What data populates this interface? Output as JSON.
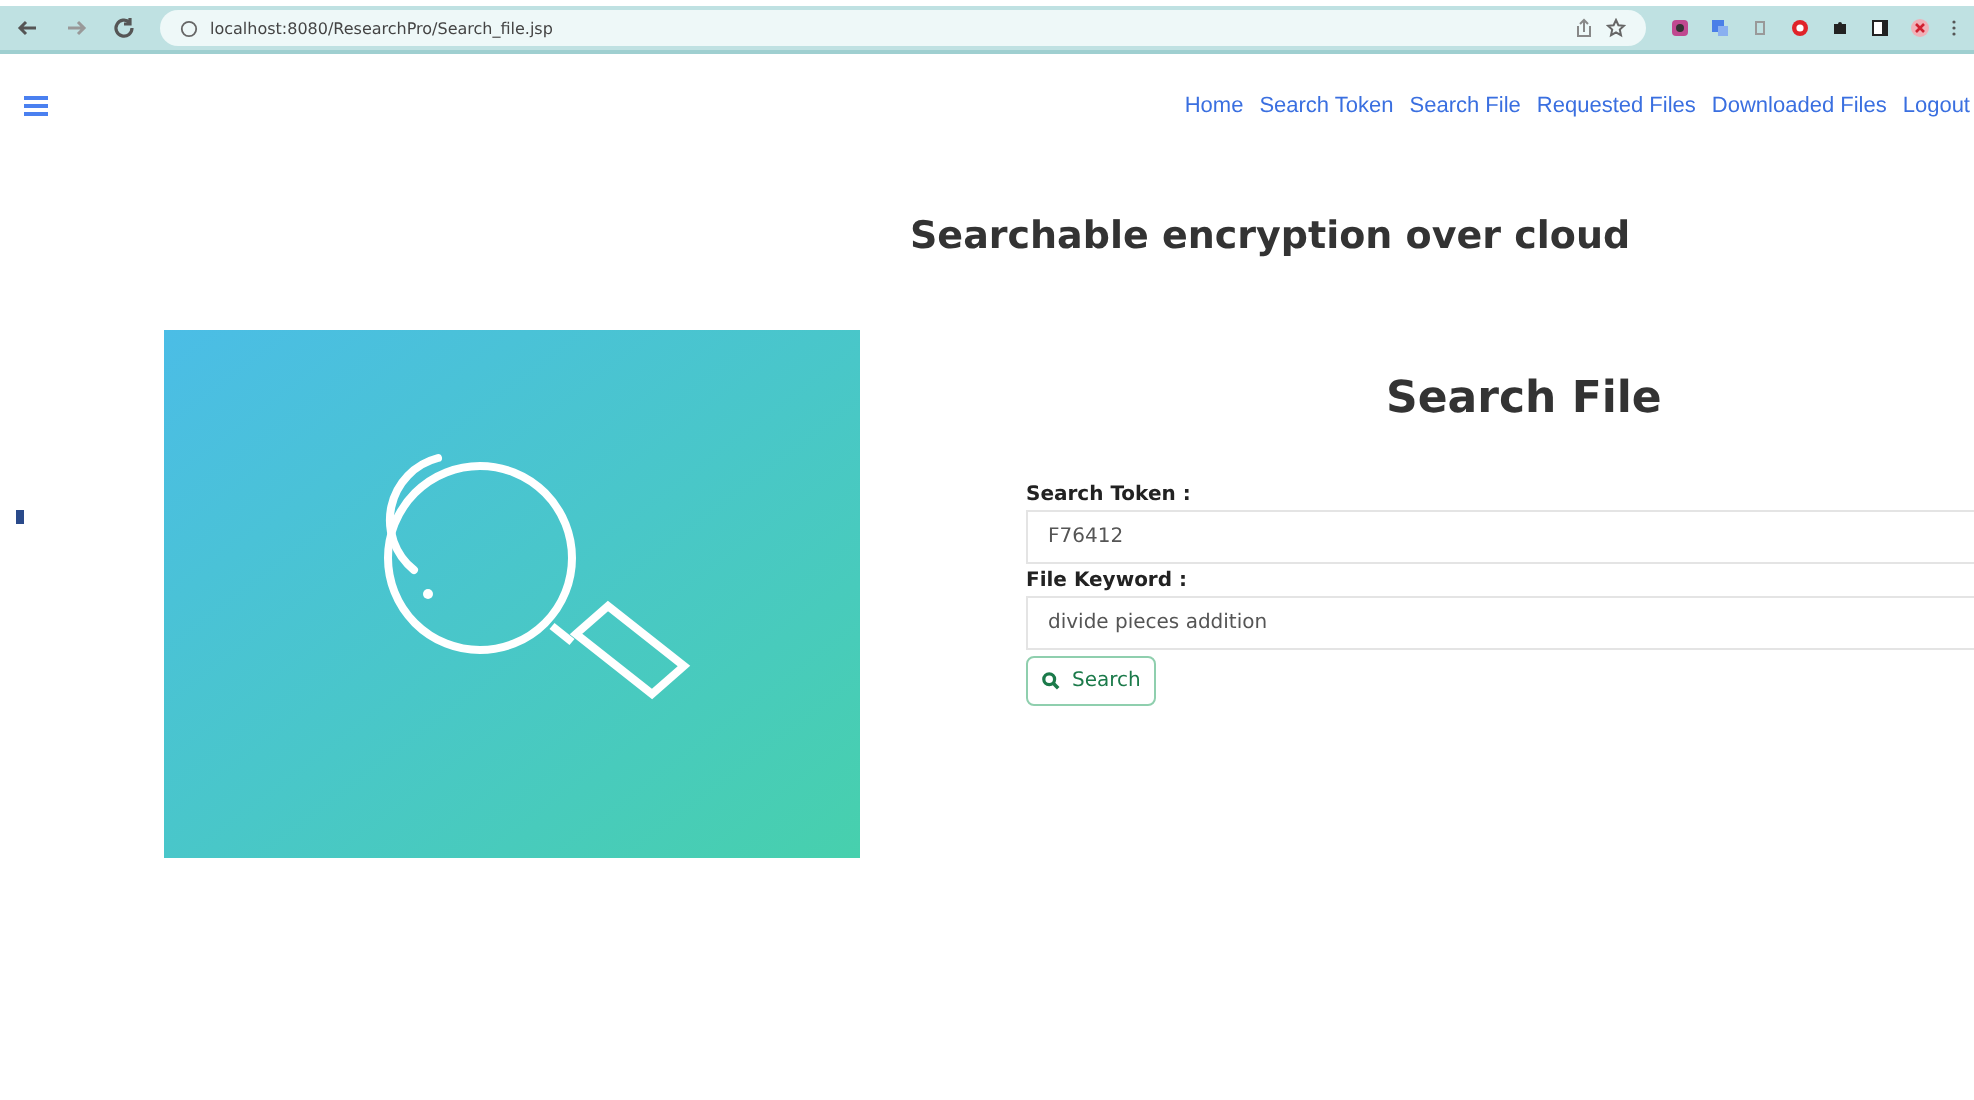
{
  "browser": {
    "url": "localhost:8080/ResearchPro/Search_file.jsp"
  },
  "nav": {
    "links": [
      "Home",
      "Search Token",
      "Search File",
      "Requested Files",
      "Downloaded Files",
      "Logout"
    ]
  },
  "page_title": "Searchable encryption over cloud",
  "form": {
    "title": "Search File",
    "fields": [
      {
        "label": "Search Token :",
        "value": "F76412"
      },
      {
        "label": "File Keyword :",
        "value": "divide pieces addition"
      }
    ],
    "button": "Search"
  }
}
